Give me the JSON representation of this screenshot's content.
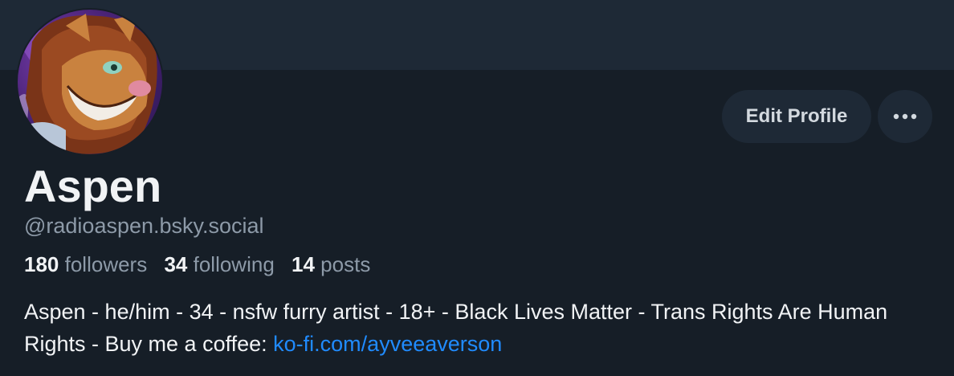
{
  "profile": {
    "display_name": "Aspen",
    "handle": "@radioaspen.bsky.social",
    "stats": {
      "followers_count": "180",
      "followers_label": "followers",
      "following_count": "34",
      "following_label": "following",
      "posts_count": "14",
      "posts_label": "posts"
    },
    "bio_text": "Aspen - he/him - 34 - nsfw furry artist - 18+ - Black Lives Matter - Trans Rights Are Human Rights - Buy me a coffee: ",
    "bio_link": "ko-fi.com/ayveeaverson"
  },
  "actions": {
    "edit_profile_label": "Edit Profile",
    "more_icon": "ellipsis-icon"
  },
  "colors": {
    "background": "#161e27",
    "banner": "#1e2936",
    "button_bg": "#1e2936",
    "muted_text": "#8d9aa8",
    "link": "#208bfe"
  }
}
